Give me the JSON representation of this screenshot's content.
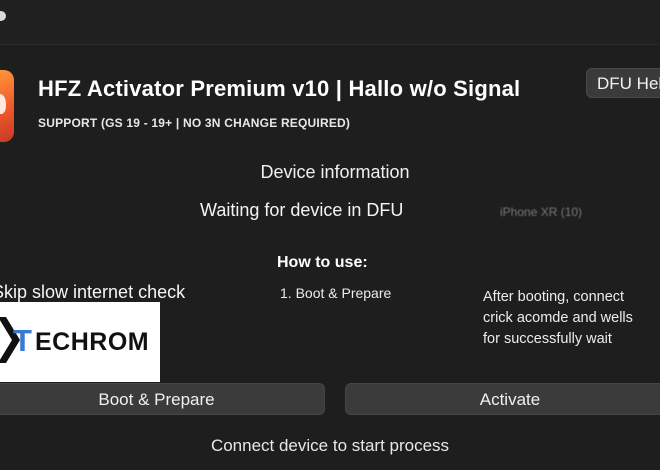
{
  "app": {
    "title": "HFZ Activator Premium v10 | Hallo w/o Signal",
    "subtitle": "SUPPORT (GS 19 - 19+ | NO 3N CHANGE REQUIRED)",
    "mode_badge": "DFU Hello"
  },
  "device": {
    "heading": "Device information",
    "status": "Waiting for device in DFU",
    "model": "iPhone XR (10)"
  },
  "howto": {
    "heading": "How to use:",
    "step_1": "1. Boot & Prepare",
    "info_lines": [
      "After booting, connect",
      "crick acomde and wells",
      "for successfully wait"
    ]
  },
  "options": {
    "skip_check_label": "Skip slow internet check"
  },
  "watermark": {
    "text": "TECHROM"
  },
  "buttons": {
    "boot_prepare": "Boot & Prepare",
    "activate": "Activate"
  },
  "footer": {
    "status": "Connect device to start process"
  },
  "colors": {
    "background": "#1e1e1e",
    "button": "#3b3b3b",
    "icon_orange": "#f0592b",
    "watermark_blue": "#3a7ad6"
  }
}
